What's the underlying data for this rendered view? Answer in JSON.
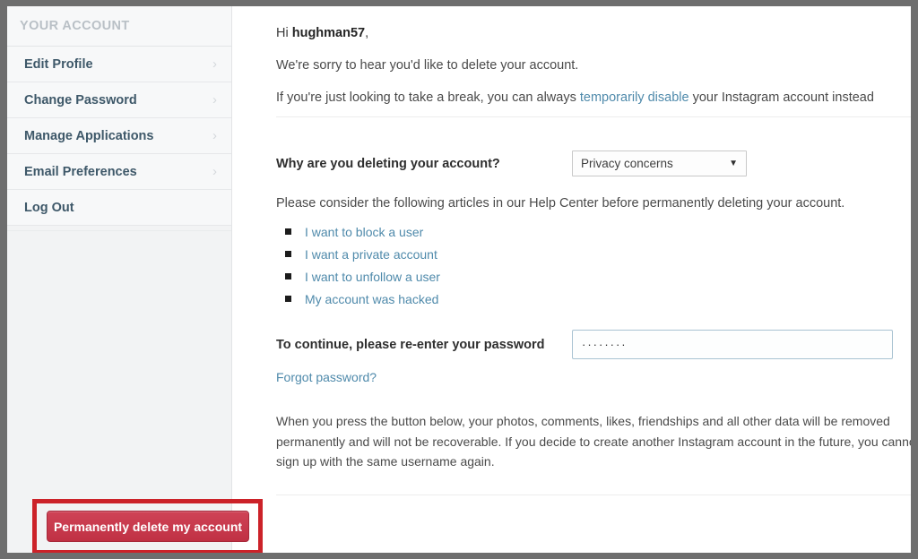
{
  "sidebar": {
    "title": "YOUR ACCOUNT",
    "items": [
      {
        "label": "Edit Profile",
        "chevron": "›"
      },
      {
        "label": "Change Password",
        "chevron": "›"
      },
      {
        "label": "Manage Applications",
        "chevron": "›"
      },
      {
        "label": "Email Preferences",
        "chevron": "›"
      },
      {
        "label": "Log Out",
        "chevron": ""
      }
    ]
  },
  "main": {
    "greeting_prefix": "Hi ",
    "username": "hughman57",
    "greeting_suffix": ",",
    "sorry_line": "We're sorry to hear you'd like to delete your account.",
    "break_line_prefix": "If you're just looking to take a break, you can always ",
    "break_link": "temporarily disable",
    "break_line_suffix": " your Instagram account instead",
    "reason_label": "Why are you deleting your account?",
    "reason_value": "Privacy concerns",
    "reason_caret": "▼",
    "help_intro": "Please consider the following articles in our Help Center before permanently deleting your account.",
    "help_links": [
      "I want to block a user",
      "I want a private account",
      "I want to unfollow a user",
      "My account was hacked"
    ],
    "password_label": "To continue, please re-enter your password",
    "password_value": "········",
    "password_placeholder": "",
    "forgot_password": "Forgot password?",
    "warning_text": "When you press the button below, your photos, comments, likes, friendships and all other data will be removed permanently and will not be recoverable. If you decide to create another Instagram account in the future, you cannot sign up with the same username again.",
    "delete_button": "Permanently delete my account"
  },
  "colors": {
    "accent_red": "#c03144",
    "highlight_red": "#cc2229",
    "link_blue": "#4f8aab",
    "sidebar_text": "#3e5869",
    "sidebar_bg": "#f2f3f4",
    "frame_gray": "#6e6e6e"
  }
}
